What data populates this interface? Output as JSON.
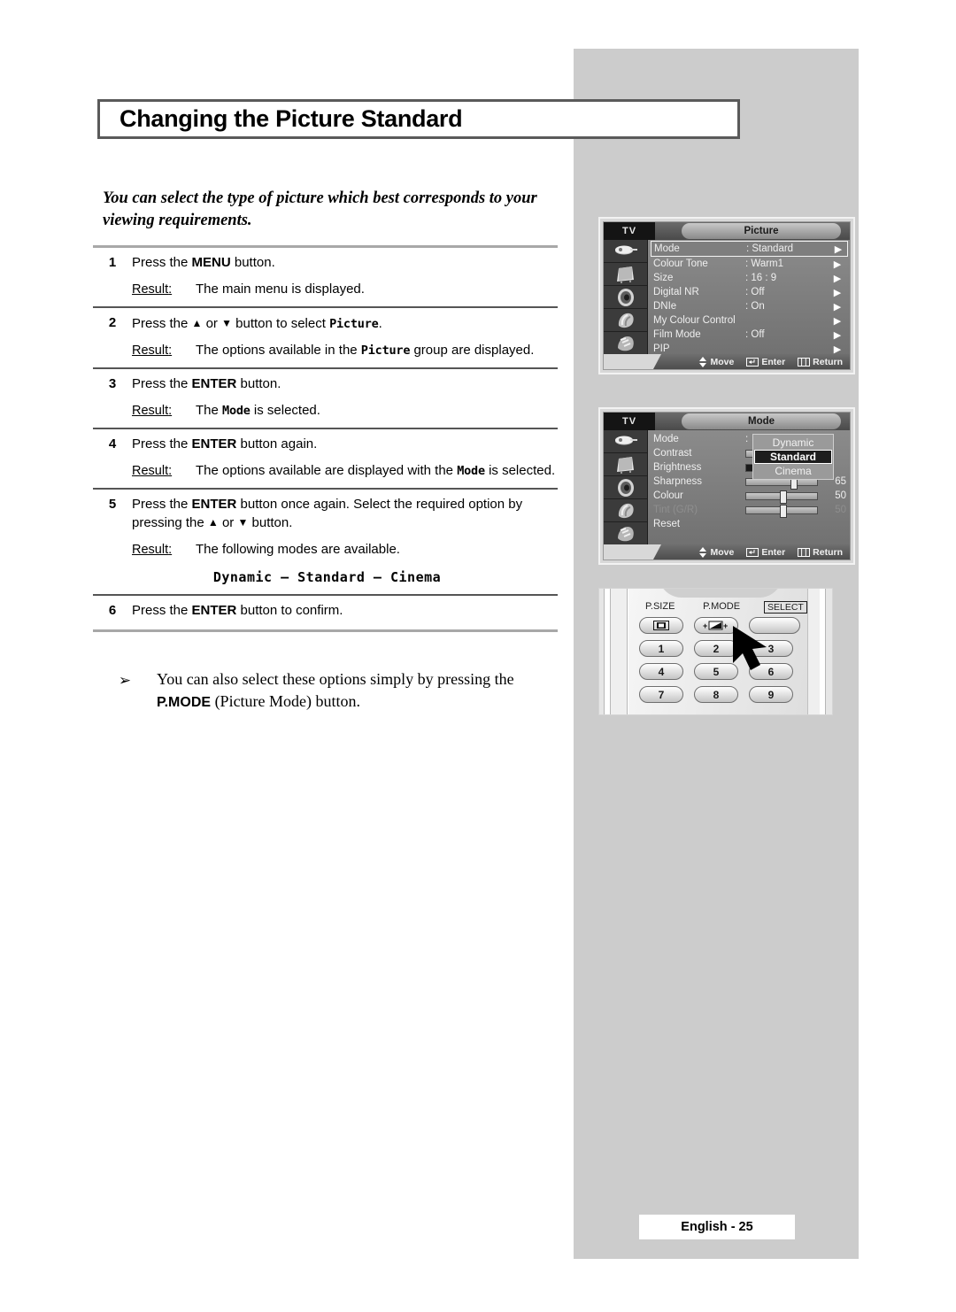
{
  "page": {
    "title": "Changing the Picture Standard",
    "intro": "You can select the type of picture which best corresponds to your viewing requirements.",
    "footer": "English - 25"
  },
  "steps": [
    {
      "num": "1",
      "lines": [
        "Press the ",
        "MENU",
        " button."
      ],
      "result_label": "Result",
      "result_text": "The main menu is displayed."
    },
    {
      "num": "2",
      "pre": "Press the ",
      "up": "▲",
      "mid": " or ",
      "down": "▼",
      "post": " button to select ",
      "target": "Picture",
      "end": ".",
      "result_label": "Result",
      "result_a": "The options available in the ",
      "result_mono": "Picture",
      "result_b": " group are displayed."
    },
    {
      "num": "3",
      "pre": "Press the ",
      "bold": "ENTER",
      "post": " button.",
      "result_label": "Result",
      "result_a": "The ",
      "result_mono": "Mode",
      "result_b": " is selected."
    },
    {
      "num": "4",
      "pre": "Press the ",
      "bold": "ENTER",
      "post": " button again.",
      "result_label": "Result",
      "result_a": "The options available are displayed with the ",
      "result_mono": "Mode",
      "result_b": " is selected."
    },
    {
      "num": "5",
      "pre": "Press the ",
      "bold": "ENTER",
      "post": " button once again. Select the required option by pressing the ",
      "up": "▲",
      "mid": " or ",
      "down": "▼",
      "tail": " button.",
      "result_label": "Result",
      "result_text": "The following modes are available.",
      "modes": "Dynamic – Standard – Cinema"
    },
    {
      "num": "6",
      "pre": "Press the ",
      "bold": "ENTER",
      "post": " button to confirm."
    }
  ],
  "note": {
    "bullet": "➢",
    "text_a": "You can also select these options simply by pressing the ",
    "text_bold": "P.MODE",
    "text_b": " (Picture Mode) button."
  },
  "osd_picture": {
    "tv_label": "TV",
    "tab": "Picture",
    "rows": [
      {
        "label": "Mode",
        "value": ": Standard",
        "chev": "▶",
        "selected": true
      },
      {
        "label": "Colour Tone",
        "value": ": Warm1",
        "chev": "▶",
        "selected": false
      },
      {
        "label": "Size",
        "value": ": 16 : 9",
        "chev": "▶",
        "selected": false
      },
      {
        "label": "Digital NR",
        "value": ": Off",
        "chev": "▶",
        "selected": false
      },
      {
        "label": "DNIe",
        "value": ": On",
        "chev": "▶",
        "selected": false
      },
      {
        "label": "My Colour Control",
        "value": "",
        "chev": "▶",
        "selected": false
      },
      {
        "label": "Film Mode",
        "value": ": Off",
        "chev": "▶",
        "selected": false
      },
      {
        "label": "PIP",
        "value": "",
        "chev": "▶",
        "selected": false
      }
    ],
    "footer": {
      "move": "Move",
      "enter": "Enter",
      "return": "Return"
    }
  },
  "osd_mode": {
    "tv_label": "TV",
    "tab": "Mode",
    "rows": [
      {
        "label": "Mode",
        "value": ":",
        "type": "value"
      },
      {
        "label": "Contrast",
        "type": "slider",
        "fill": 0,
        "knob": 62,
        "num": ""
      },
      {
        "label": "Brightness",
        "type": "slider",
        "fill": 45,
        "knob": 45,
        "num": ""
      },
      {
        "label": "Sharpness",
        "type": "slider",
        "fill": 0,
        "knob": 62,
        "num": "65"
      },
      {
        "label": "Colour",
        "type": "slider",
        "fill": 0,
        "knob": 48,
        "num": "50"
      },
      {
        "label": "Tint (G/R)",
        "type": "slider",
        "fill": 0,
        "knob": 48,
        "num": "50",
        "dim": true
      },
      {
        "label": "Reset",
        "type": "value",
        "value": ""
      }
    ],
    "popup": [
      {
        "label": "Dynamic",
        "active": false
      },
      {
        "label": "Standard",
        "active": true
      },
      {
        "label": "Cinema",
        "active": false
      }
    ],
    "footer": {
      "move": "Move",
      "enter": "Enter",
      "return": "Return"
    }
  },
  "remote": {
    "labels": [
      "P.SIZE",
      "P.MODE",
      "SELECT"
    ],
    "keys_row1": [
      "1",
      "2",
      "3"
    ],
    "keys_row2": [
      "4",
      "5",
      "6"
    ],
    "keys_row3": [
      "7",
      "8",
      "9"
    ]
  }
}
